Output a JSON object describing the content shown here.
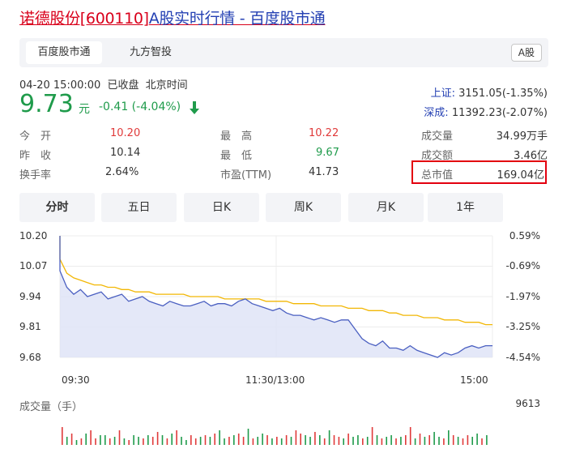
{
  "page": {
    "title_stock": "诺德股份[600110]",
    "title_rest": "A股实时行情 - 百度股市通"
  },
  "tabs": {
    "items": [
      "百度股市通",
      "九方智投"
    ],
    "badge": "A股"
  },
  "quote": {
    "datetime": "04-20 15:00:00",
    "status": "已收盘",
    "timezone": "北京时间",
    "price": "9.73",
    "unit": "元",
    "change": "-0.41 (-4.04%)"
  },
  "indices": {
    "sh_label": "上证:",
    "sh_value": "3151.05(-1.35%)",
    "sz_label": "深成:",
    "sz_value": "11392.23(-2.07%)"
  },
  "stats": {
    "open_label": "今　开",
    "open_value": "10.20",
    "high_label": "最　高",
    "high_value": "10.22",
    "volume_label": "成交量",
    "volume_value": "34.99万手",
    "prev_label": "昨　收",
    "prev_value": "10.14",
    "low_label": "最　低",
    "low_value": "9.67",
    "amount_label": "成交额",
    "amount_value": "3.46亿",
    "turnover_label": "换手率",
    "turnover_value": "2.64%",
    "pe_label": "市盈(TTM)",
    "pe_value": "41.73",
    "mcap_label": "总市值",
    "mcap_value": "169.04亿"
  },
  "period_tabs": [
    "分时",
    "五日",
    "日K",
    "周K",
    "月K",
    "1年"
  ],
  "colors": {
    "price_line": "#4a5fc1",
    "avg_line": "#f2b705",
    "fill": "#dfe4f7",
    "up": "#e03a3a",
    "down": "#1f9b4b",
    "highlight_box": "#e3000f"
  },
  "chart_data": {
    "type": "line",
    "y_left_ticks": [
      "10.20",
      "10.07",
      "9.94",
      "9.81",
      "9.68"
    ],
    "y_right_ticks": [
      "0.59%",
      "-0.69%",
      "-1.97%",
      "-3.25%",
      "-4.54%"
    ],
    "x_ticks": [
      "09:30",
      "11:30/13:00",
      "15:00"
    ],
    "ylim": [
      9.68,
      10.2
    ],
    "series": [
      {
        "values": [
          10.05,
          9.98,
          9.95,
          9.97,
          9.94,
          9.95,
          9.96,
          9.93,
          9.94,
          9.95,
          9.92,
          9.93,
          9.94,
          9.92,
          9.91,
          9.9,
          9.92,
          9.91,
          9.9,
          9.9,
          9.91,
          9.92,
          9.9,
          9.91,
          9.91,
          9.9,
          9.92,
          9.93,
          9.91,
          9.9,
          9.89,
          9.88,
          9.89,
          9.87,
          9.86,
          9.86,
          9.85,
          9.84,
          9.85,
          9.84,
          9.83,
          9.84,
          9.84,
          9.8,
          9.76,
          9.74,
          9.73,
          9.75,
          9.72,
          9.72,
          9.71,
          9.73,
          9.71,
          9.7,
          9.69,
          9.68,
          9.7,
          9.69,
          9.7,
          9.72,
          9.73,
          9.72,
          9.73,
          9.73
        ]
      },
      {
        "values": [
          10.1,
          10.04,
          10.02,
          10.01,
          10.0,
          9.99,
          9.99,
          9.98,
          9.98,
          9.97,
          9.97,
          9.96,
          9.96,
          9.96,
          9.95,
          9.95,
          9.95,
          9.95,
          9.95,
          9.94,
          9.94,
          9.94,
          9.94,
          9.94,
          9.93,
          9.93,
          9.93,
          9.93,
          9.93,
          9.93,
          9.92,
          9.92,
          9.92,
          9.92,
          9.91,
          9.91,
          9.91,
          9.91,
          9.9,
          9.9,
          9.9,
          9.9,
          9.89,
          9.89,
          9.89,
          9.88,
          9.88,
          9.88,
          9.87,
          9.87,
          9.86,
          9.86,
          9.86,
          9.85,
          9.85,
          9.85,
          9.84,
          9.84,
          9.84,
          9.83,
          9.83,
          9.83,
          9.82,
          9.82
        ]
      }
    ]
  },
  "volume": {
    "label": "成交量（手）",
    "max": "9613",
    "bars": [
      0.55,
      0.25,
      0.35,
      0.15,
      0.2,
      0.35,
      0.45,
      0.2,
      0.3,
      0.3,
      0.2,
      0.25,
      0.45,
      0.2,
      0.15,
      0.3,
      0.25,
      0.2,
      0.3,
      0.25,
      0.4,
      0.3,
      0.2,
      0.35,
      0.45,
      0.25,
      0.15,
      0.3,
      0.2,
      0.25,
      0.3,
      0.25,
      0.35,
      0.45,
      0.2,
      0.25,
      0.3,
      0.35,
      0.25,
      0.5,
      0.2,
      0.25,
      0.35,
      0.3,
      0.2,
      0.25,
      0.2,
      0.3,
      0.25,
      0.45,
      0.35,
      0.3,
      0.25,
      0.4,
      0.3,
      0.2,
      0.45,
      0.3,
      0.25,
      0.2,
      0.35,
      0.25,
      0.3,
      0.2,
      0.25,
      0.55,
      0.3,
      0.2,
      0.25,
      0.3,
      0.2,
      0.25,
      0.3,
      0.55,
      0.2,
      0.35,
      0.25,
      0.3,
      0.4,
      0.25,
      0.2,
      0.45,
      0.3,
      0.25,
      0.2,
      0.3,
      0.25,
      0.35,
      0.2,
      0.3
    ],
    "up": [
      1,
      0,
      1,
      0,
      1,
      0,
      1,
      1,
      0,
      0,
      1,
      0,
      1,
      0,
      1,
      0,
      0,
      1,
      0,
      1,
      1,
      0,
      1,
      0,
      1,
      0,
      0,
      1,
      1,
      0,
      1,
      0,
      1,
      0,
      0,
      1,
      0,
      1,
      1,
      0,
      1,
      0,
      0,
      1,
      0,
      1,
      0,
      1,
      0,
      1,
      1,
      0,
      0,
      1,
      0,
      1,
      0,
      1,
      1,
      0,
      1,
      0,
      0,
      1,
      0,
      1,
      0,
      1,
      0,
      0,
      1,
      0,
      1,
      1,
      0,
      1,
      0,
      1,
      0,
      0,
      1,
      0,
      1,
      0,
      1,
      1,
      0,
      0,
      1,
      0
    ]
  }
}
